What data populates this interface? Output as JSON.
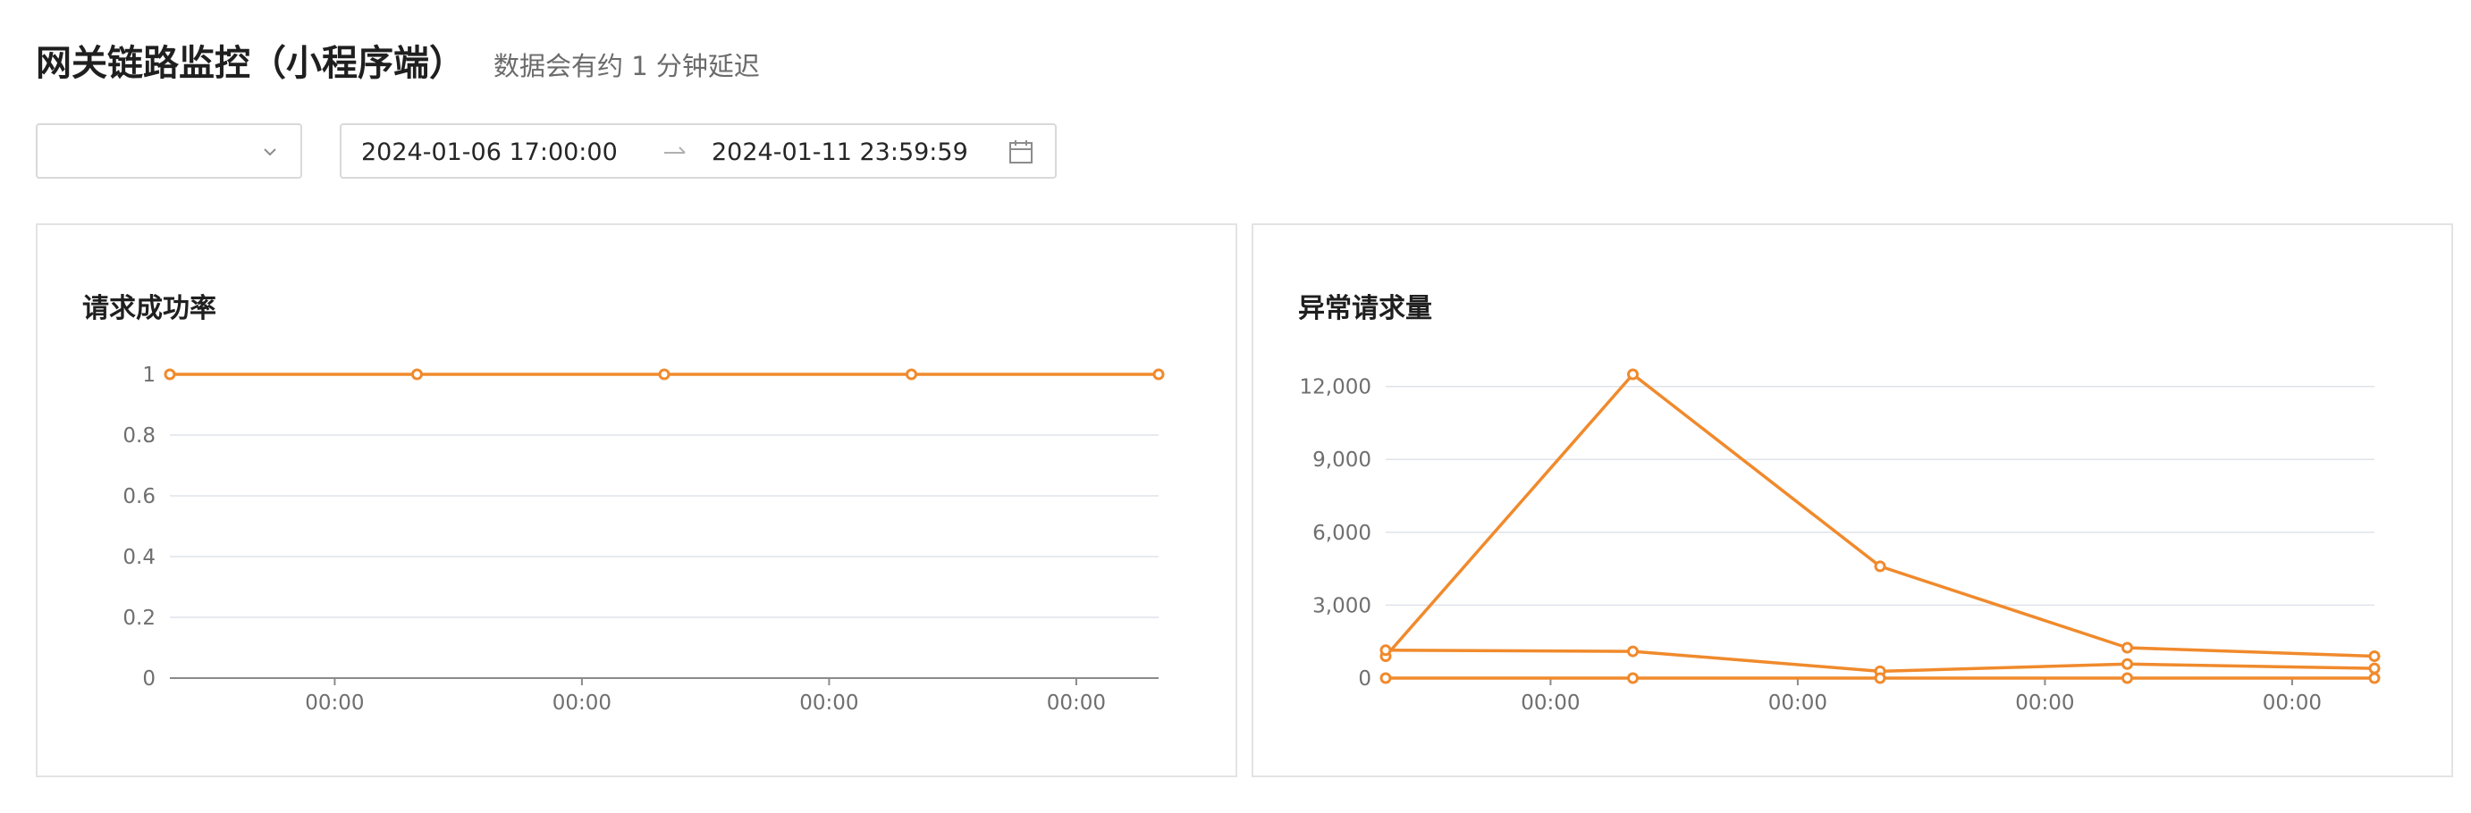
{
  "header": {
    "title": "网关链路监控（小程序端）",
    "subtitle": "数据会有约 1 分钟延迟"
  },
  "filters": {
    "select_value": "",
    "range_start": "2024-01-06 17:00:00",
    "range_end": "2024-01-11 23:59:59",
    "icons": {
      "select": "chevron-down-icon",
      "range_separator": "arrow-right-icon",
      "calendar": "calendar-icon"
    }
  },
  "colors": {
    "series": "#f08a2c",
    "grid": "#dfe3ea",
    "axis": "#6f6f6f"
  },
  "chart_data": [
    {
      "type": "line",
      "title": "请求成功率",
      "ylim": [
        0,
        1
      ],
      "yticks": [
        "0",
        "0.2",
        "0.4",
        "0.6",
        "0.8",
        "1"
      ],
      "ytick_values": [
        0,
        0.2,
        0.4,
        0.6,
        0.8,
        1
      ],
      "xticks": [
        "00:00",
        "00:00",
        "00:00",
        "00:00"
      ],
      "x_positions": [
        0,
        1,
        2,
        3,
        4
      ],
      "xtick_positions": [
        0.667,
        1.667,
        2.667,
        3.667
      ],
      "grid": true,
      "series": [
        {
          "values": [
            1,
            1,
            1,
            1,
            1
          ]
        }
      ]
    },
    {
      "type": "line",
      "title": "异常请求量",
      "ylim": [
        0,
        12500
      ],
      "yticks": [
        "0",
        "3,000",
        "6,000",
        "9,000",
        "12,000"
      ],
      "ytick_values": [
        0,
        3000,
        6000,
        9000,
        12000
      ],
      "xticks": [
        "00:00",
        "00:00",
        "00:00",
        "00:00"
      ],
      "x_positions": [
        0,
        1,
        2,
        3,
        4
      ],
      "xtick_positions": [
        0.667,
        1.667,
        2.667,
        3.667
      ],
      "grid": true,
      "series": [
        {
          "values": [
            900,
            12500,
            4600,
            1250,
            900
          ]
        },
        {
          "values": [
            1150,
            1100,
            280,
            580,
            400
          ]
        },
        {
          "values": [
            0,
            0,
            0,
            0,
            0
          ]
        }
      ]
    }
  ]
}
